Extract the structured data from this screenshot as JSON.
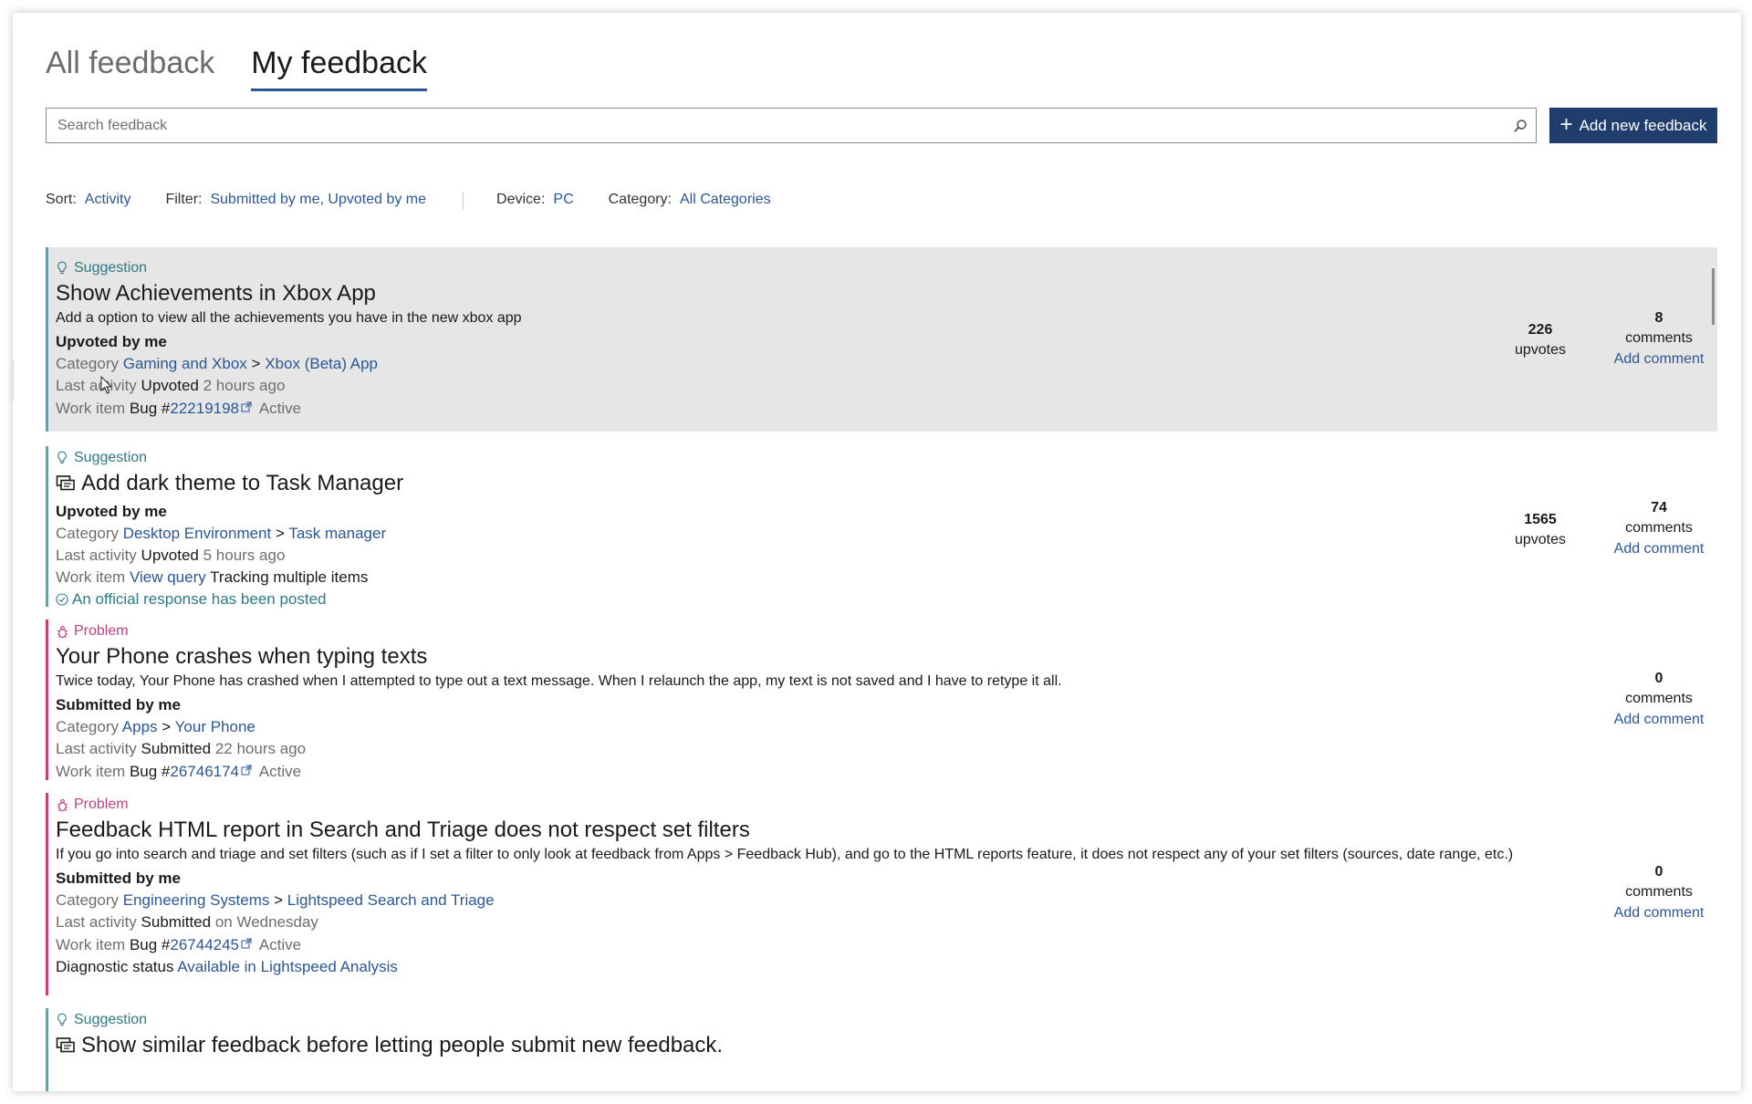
{
  "tabs": [
    {
      "label": "All feedback",
      "active": false
    },
    {
      "label": "My feedback",
      "active": true
    }
  ],
  "search": {
    "placeholder": "Search feedback",
    "value": ""
  },
  "add_button": {
    "label": "Add new feedback"
  },
  "filters": {
    "sort_label": "Sort:",
    "sort_value": "Activity",
    "filter_label": "Filter:",
    "filter_value": "Submitted by me, Upvoted by me",
    "device_label": "Device:",
    "device_value": "PC",
    "category_label": "Category:",
    "category_value": "All Categories"
  },
  "labels": {
    "category": "Category",
    "last_activity": "Last activity",
    "work_item": "Work item",
    "diagnostic_status": "Diagnostic status",
    "upvotes": "upvotes",
    "comments": "comments",
    "add_comment": "Add comment",
    "bug_prefix": "Bug #"
  },
  "items": [
    {
      "type": "Suggestion",
      "title": "Show Achievements in Xbox App",
      "description": "Add a option to view all the achievements you have in the new xbox app",
      "status": "Upvoted by me",
      "category_parent": "Gaming and Xbox",
      "category_sep": ">",
      "category_child": "Xbox (Beta) App",
      "activity_action": "Upvoted",
      "activity_time": "2 hours ago",
      "bug_number": "22219198",
      "bug_state": "Active",
      "upvotes": "226",
      "comments": "8"
    },
    {
      "type": "Suggestion",
      "title": "Add dark theme to Task Manager",
      "status": "Upvoted by me",
      "category_parent": "Desktop Environment",
      "category_sep": ">",
      "category_child": "Task manager",
      "activity_action": "Upvoted",
      "activity_time": "5 hours ago",
      "work_link": "View query",
      "work_note": "Tracking multiple items",
      "official_response": "An official response has been posted",
      "upvotes": "1565",
      "comments": "74"
    },
    {
      "type": "Problem",
      "title": "Your Phone crashes when typing texts",
      "description": "Twice today, Your Phone has crashed when I attempted to type out a text message. When I relaunch the app, my text is not saved and I have to retype it all.",
      "status": "Submitted by me",
      "category_parent": "Apps",
      "category_sep": ">",
      "category_child": "Your Phone",
      "activity_action": "Submitted",
      "activity_time": "22 hours ago",
      "bug_number": "26746174",
      "bug_state": "Active",
      "comments": "0"
    },
    {
      "type": "Problem",
      "title": "Feedback HTML report in Search and Triage does not respect set filters",
      "description": "If you go into search and triage and set filters (such as if I set a filter to only look at feedback from Apps > Feedback Hub), and go to the HTML reports feature, it does not respect any of your set filters (sources, date range, etc.)",
      "status": "Submitted by me",
      "category_parent": "Engineering Systems",
      "category_sep": ">",
      "category_child": "Lightspeed Search and Triage",
      "activity_action": "Submitted",
      "activity_time": "on Wednesday",
      "bug_number": "26744245",
      "bug_state": "Active",
      "diagnostic_status": "Available in Lightspeed Analysis",
      "comments": "0"
    },
    {
      "type": "Suggestion",
      "title": "Show similar feedback before letting people submit new feedback."
    }
  ],
  "icons": {
    "suggestion": "lightbulb-icon",
    "problem": "bug-icon",
    "search": "search-icon",
    "add": "plus-icon",
    "external": "external-link-icon",
    "official": "check-circle-icon",
    "multi": "multiple-items-icon"
  },
  "colors": {
    "accent": "#2b5797",
    "button": "#1f3e6e",
    "suggestion": "#2d7a86",
    "problem": "#c43e7e",
    "selected_bg": "#e6e6e6"
  }
}
